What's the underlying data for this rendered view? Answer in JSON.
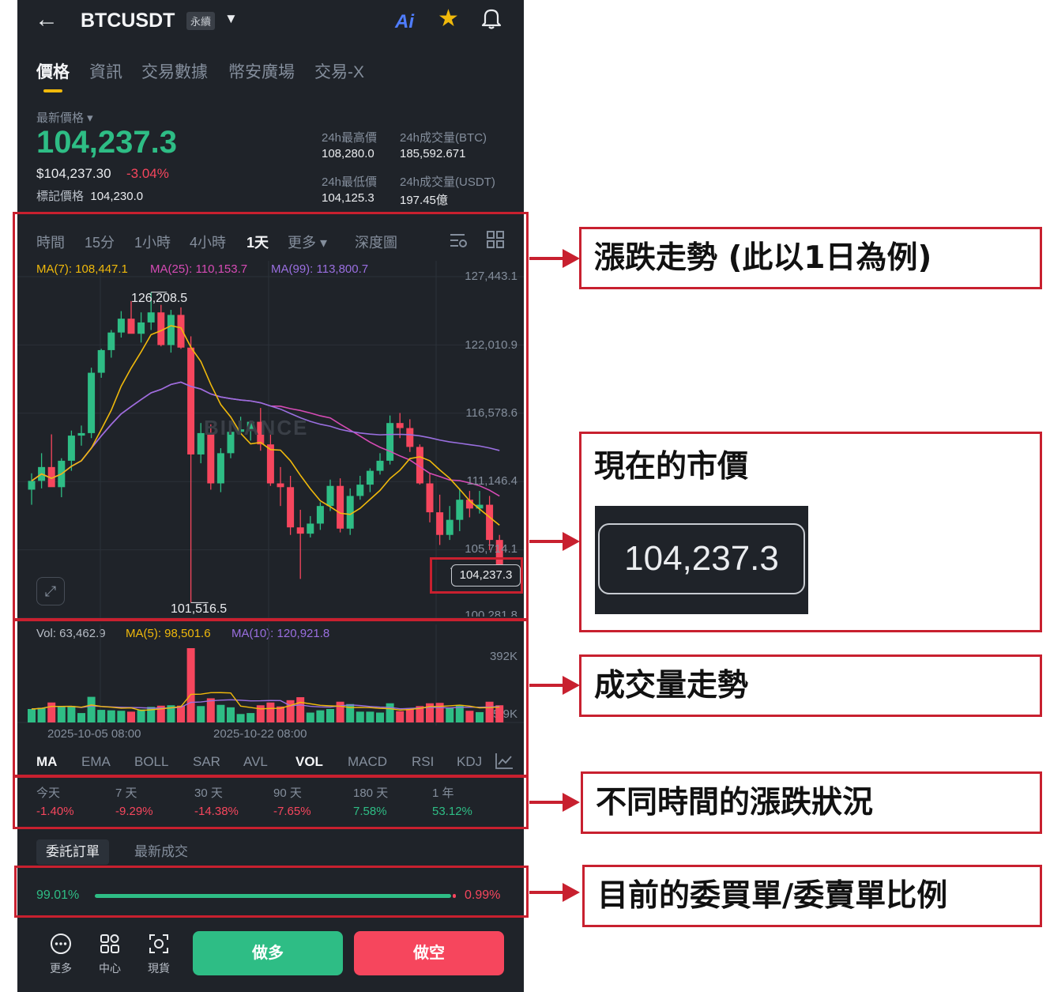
{
  "header": {
    "back_icon": "arrow-left-icon",
    "symbol": "BTCUSDT",
    "contract_type": "永續",
    "ai_label": "Ai",
    "favorite_icon": "star-icon",
    "alert_icon": "bell-icon"
  },
  "tabs": [
    {
      "label": "價格",
      "active": true
    },
    {
      "label": "資訊"
    },
    {
      "label": "交易數據"
    },
    {
      "label": "幣安廣場"
    },
    {
      "label": "交易-X"
    }
  ],
  "price": {
    "last_label": "最新價格",
    "last_value": "104,237.3",
    "usd_value": "$104,237.30",
    "change_pct": "-3.04%",
    "mark_label": "標記價格",
    "mark_value": "104,230.0",
    "high_label": "24h最高價",
    "high_value": "108,280.0",
    "low_label": "24h最低價",
    "low_value": "104,125.3",
    "vol_btc_label": "24h成交量(BTC)",
    "vol_btc_value": "185,592.671",
    "vol_usdt_label": "24h成交量(USDT)",
    "vol_usdt_value": "197.45億"
  },
  "timeframes": {
    "items": [
      "時間",
      "15分",
      "1小時",
      "4小時",
      "1天",
      "更多",
      "深度圖"
    ],
    "active": "1天",
    "more_caret": "▾",
    "settings_icon": "chart-settings-icon",
    "layout_icon": "grid-icon"
  },
  "chart_labels": {
    "ma7": "MA(7): 108,447.1",
    "ma25": "MA(25): 110,153.7",
    "ma99": "MA(99): 113,800.7",
    "high_marker": "126,208.5",
    "low_marker": "101,516.5",
    "current_price_tag": "104,237.3",
    "watermark": "BINANCE",
    "vol": "Vol: 63,462.9",
    "vol_ma5": "MA(5): 98,501.6",
    "vol_ma10": "MA(10): 120,921.8"
  },
  "chart_data": {
    "type": "candlestick",
    "y_ticks": [
      "127,443.1",
      "122,010.9",
      "116,578.6",
      "111,146.4",
      "105,714.1",
      "100,281.8"
    ],
    "ylim": [
      100281.8,
      127443.1
    ],
    "x_ticks": [
      "2025-10-05 08:00",
      "2025-10-22 08:00"
    ],
    "candles": [
      [
        110500,
        111800,
        109300,
        111200
      ],
      [
        111200,
        113400,
        110600,
        112300
      ],
      [
        112300,
        114900,
        110800,
        110700
      ],
      [
        110700,
        113000,
        109900,
        112800
      ],
      [
        112800,
        115200,
        112000,
        114800
      ],
      [
        114800,
        115600,
        114000,
        115000
      ],
      [
        115000,
        120200,
        114600,
        119800
      ],
      [
        119800,
        121700,
        119400,
        121600
      ],
      [
        121600,
        123200,
        121000,
        123000
      ],
      [
        123000,
        124700,
        122600,
        124100
      ],
      [
        124100,
        125500,
        123600,
        122900
      ],
      [
        122900,
        124600,
        122200,
        123800
      ],
      [
        123800,
        126208.5,
        123200,
        124600
      ],
      [
        124600,
        125200,
        121900,
        122000
      ],
      [
        122000,
        124800,
        121400,
        124400
      ],
      [
        124400,
        125000,
        121700,
        121800
      ],
      [
        121800,
        122700,
        101516.5,
        113300
      ],
      [
        113300,
        115800,
        112600,
        115000
      ],
      [
        115000,
        115700,
        110500,
        111000
      ],
      [
        111000,
        113800,
        110300,
        113400
      ],
      [
        113400,
        115900,
        113000,
        115100
      ],
      [
        115100,
        116300,
        114900,
        115300
      ],
      [
        115300,
        116000,
        114400,
        115900
      ],
      [
        115900,
        117000,
        113600,
        114100
      ],
      [
        114100,
        114900,
        110800,
        111000
      ],
      [
        111000,
        112300,
        109200,
        110700
      ],
      [
        110700,
        111600,
        106900,
        107500
      ],
      [
        107500,
        108900,
        103400,
        107000
      ],
      [
        107000,
        108400,
        106700,
        107800
      ],
      [
        107800,
        109500,
        107300,
        109200
      ],
      [
        109200,
        111300,
        108800,
        110800
      ],
      [
        110800,
        111400,
        107100,
        107400
      ],
      [
        107400,
        110600,
        106900,
        110000
      ],
      [
        110000,
        111600,
        109700,
        110900
      ],
      [
        110900,
        112200,
        110300,
        112000
      ],
      [
        112000,
        113400,
        111700,
        112800
      ],
      [
        112800,
        116400,
        112500,
        115800
      ],
      [
        115800,
        116600,
        114600,
        115400
      ],
      [
        115400,
        116100,
        113500,
        113900
      ],
      [
        113900,
        114100,
        110900,
        111000
      ],
      [
        111000,
        111800,
        107900,
        108700
      ],
      [
        108700,
        110100,
        106100,
        106900
      ],
      [
        106900,
        109200,
        106500,
        108100
      ],
      [
        108100,
        110600,
        107200,
        109700
      ],
      [
        109700,
        110400,
        108300,
        109000
      ],
      [
        109000,
        110400,
        108600,
        109300
      ],
      [
        109300,
        110000,
        105700,
        106500
      ],
      [
        106500,
        106900,
        103500,
        104237.3
      ]
    ],
    "volume_ticks": [
      "392K",
      "35.9K"
    ]
  },
  "indicators": {
    "items": [
      "MA",
      "EMA",
      "BOLL",
      "SAR",
      "AVL",
      "VOL",
      "MACD",
      "RSI",
      "KDJ"
    ],
    "active": [
      "MA",
      "VOL"
    ],
    "more_icon": "indicator-chart-icon"
  },
  "performance": [
    {
      "label": "今天",
      "value": "-1.40%",
      "positive": false
    },
    {
      "label": "7 天",
      "value": "-9.29%",
      "positive": false
    },
    {
      "label": "30 天",
      "value": "-14.38%",
      "positive": false
    },
    {
      "label": "90 天",
      "value": "-7.65%",
      "positive": false
    },
    {
      "label": "180 天",
      "value": "7.58%",
      "positive": true
    },
    {
      "label": "1 年",
      "value": "53.12%",
      "positive": true
    }
  ],
  "orderbook": {
    "tab_orders": "委託訂單",
    "tab_trades": "最新成交",
    "buy_ratio": "99.01%",
    "sell_ratio": "0.99%",
    "buy_fraction": 0.9901
  },
  "bottom_nav": {
    "more_label": "更多",
    "center_label": "中心",
    "spot_label": "現貨",
    "long_button": "做多",
    "short_button": "做空"
  },
  "annotations": {
    "trend": "漲跌走勢 (此以1日為例)",
    "market_price": "現在的市價",
    "market_price_zoom": "104,237.3",
    "volume": "成交量走勢",
    "periods": "不同時間的漲跌狀況",
    "ratio": "目前的委買單/委賣單比例"
  },
  "colors": {
    "up": "#2ebd85",
    "down": "#f6465d",
    "accent": "#f0b90b",
    "ma7": "#f0b90b",
    "ma25": "#d64bb5",
    "ma99": "#9a6fe0",
    "annotation": "#c8202f"
  }
}
